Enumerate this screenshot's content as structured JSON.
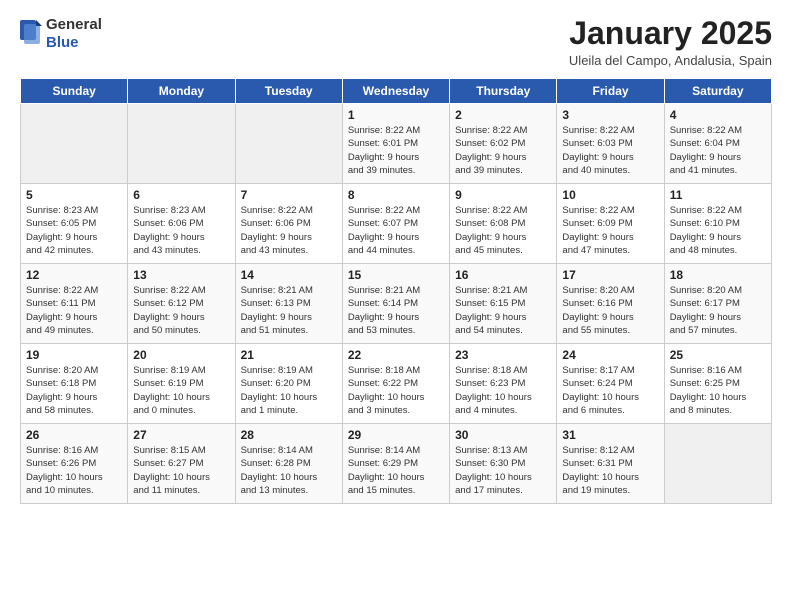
{
  "logo": {
    "general": "General",
    "blue": "Blue"
  },
  "title": {
    "month": "January 2025",
    "location": "Uleila del Campo, Andalusia, Spain"
  },
  "weekdays": [
    "Sunday",
    "Monday",
    "Tuesday",
    "Wednesday",
    "Thursday",
    "Friday",
    "Saturday"
  ],
  "weeks": [
    [
      {
        "day": "",
        "info": ""
      },
      {
        "day": "",
        "info": ""
      },
      {
        "day": "",
        "info": ""
      },
      {
        "day": "1",
        "info": "Sunrise: 8:22 AM\nSunset: 6:01 PM\nDaylight: 9 hours\nand 39 minutes."
      },
      {
        "day": "2",
        "info": "Sunrise: 8:22 AM\nSunset: 6:02 PM\nDaylight: 9 hours\nand 39 minutes."
      },
      {
        "day": "3",
        "info": "Sunrise: 8:22 AM\nSunset: 6:03 PM\nDaylight: 9 hours\nand 40 minutes."
      },
      {
        "day": "4",
        "info": "Sunrise: 8:22 AM\nSunset: 6:04 PM\nDaylight: 9 hours\nand 41 minutes."
      }
    ],
    [
      {
        "day": "5",
        "info": "Sunrise: 8:23 AM\nSunset: 6:05 PM\nDaylight: 9 hours\nand 42 minutes."
      },
      {
        "day": "6",
        "info": "Sunrise: 8:23 AM\nSunset: 6:06 PM\nDaylight: 9 hours\nand 43 minutes."
      },
      {
        "day": "7",
        "info": "Sunrise: 8:22 AM\nSunset: 6:06 PM\nDaylight: 9 hours\nand 43 minutes."
      },
      {
        "day": "8",
        "info": "Sunrise: 8:22 AM\nSunset: 6:07 PM\nDaylight: 9 hours\nand 44 minutes."
      },
      {
        "day": "9",
        "info": "Sunrise: 8:22 AM\nSunset: 6:08 PM\nDaylight: 9 hours\nand 45 minutes."
      },
      {
        "day": "10",
        "info": "Sunrise: 8:22 AM\nSunset: 6:09 PM\nDaylight: 9 hours\nand 47 minutes."
      },
      {
        "day": "11",
        "info": "Sunrise: 8:22 AM\nSunset: 6:10 PM\nDaylight: 9 hours\nand 48 minutes."
      }
    ],
    [
      {
        "day": "12",
        "info": "Sunrise: 8:22 AM\nSunset: 6:11 PM\nDaylight: 9 hours\nand 49 minutes."
      },
      {
        "day": "13",
        "info": "Sunrise: 8:22 AM\nSunset: 6:12 PM\nDaylight: 9 hours\nand 50 minutes."
      },
      {
        "day": "14",
        "info": "Sunrise: 8:21 AM\nSunset: 6:13 PM\nDaylight: 9 hours\nand 51 minutes."
      },
      {
        "day": "15",
        "info": "Sunrise: 8:21 AM\nSunset: 6:14 PM\nDaylight: 9 hours\nand 53 minutes."
      },
      {
        "day": "16",
        "info": "Sunrise: 8:21 AM\nSunset: 6:15 PM\nDaylight: 9 hours\nand 54 minutes."
      },
      {
        "day": "17",
        "info": "Sunrise: 8:20 AM\nSunset: 6:16 PM\nDaylight: 9 hours\nand 55 minutes."
      },
      {
        "day": "18",
        "info": "Sunrise: 8:20 AM\nSunset: 6:17 PM\nDaylight: 9 hours\nand 57 minutes."
      }
    ],
    [
      {
        "day": "19",
        "info": "Sunrise: 8:20 AM\nSunset: 6:18 PM\nDaylight: 9 hours\nand 58 minutes."
      },
      {
        "day": "20",
        "info": "Sunrise: 8:19 AM\nSunset: 6:19 PM\nDaylight: 10 hours\nand 0 minutes."
      },
      {
        "day": "21",
        "info": "Sunrise: 8:19 AM\nSunset: 6:20 PM\nDaylight: 10 hours\nand 1 minute."
      },
      {
        "day": "22",
        "info": "Sunrise: 8:18 AM\nSunset: 6:22 PM\nDaylight: 10 hours\nand 3 minutes."
      },
      {
        "day": "23",
        "info": "Sunrise: 8:18 AM\nSunset: 6:23 PM\nDaylight: 10 hours\nand 4 minutes."
      },
      {
        "day": "24",
        "info": "Sunrise: 8:17 AM\nSunset: 6:24 PM\nDaylight: 10 hours\nand 6 minutes."
      },
      {
        "day": "25",
        "info": "Sunrise: 8:16 AM\nSunset: 6:25 PM\nDaylight: 10 hours\nand 8 minutes."
      }
    ],
    [
      {
        "day": "26",
        "info": "Sunrise: 8:16 AM\nSunset: 6:26 PM\nDaylight: 10 hours\nand 10 minutes."
      },
      {
        "day": "27",
        "info": "Sunrise: 8:15 AM\nSunset: 6:27 PM\nDaylight: 10 hours\nand 11 minutes."
      },
      {
        "day": "28",
        "info": "Sunrise: 8:14 AM\nSunset: 6:28 PM\nDaylight: 10 hours\nand 13 minutes."
      },
      {
        "day": "29",
        "info": "Sunrise: 8:14 AM\nSunset: 6:29 PM\nDaylight: 10 hours\nand 15 minutes."
      },
      {
        "day": "30",
        "info": "Sunrise: 8:13 AM\nSunset: 6:30 PM\nDaylight: 10 hours\nand 17 minutes."
      },
      {
        "day": "31",
        "info": "Sunrise: 8:12 AM\nSunset: 6:31 PM\nDaylight: 10 hours\nand 19 minutes."
      },
      {
        "day": "",
        "info": ""
      }
    ]
  ]
}
